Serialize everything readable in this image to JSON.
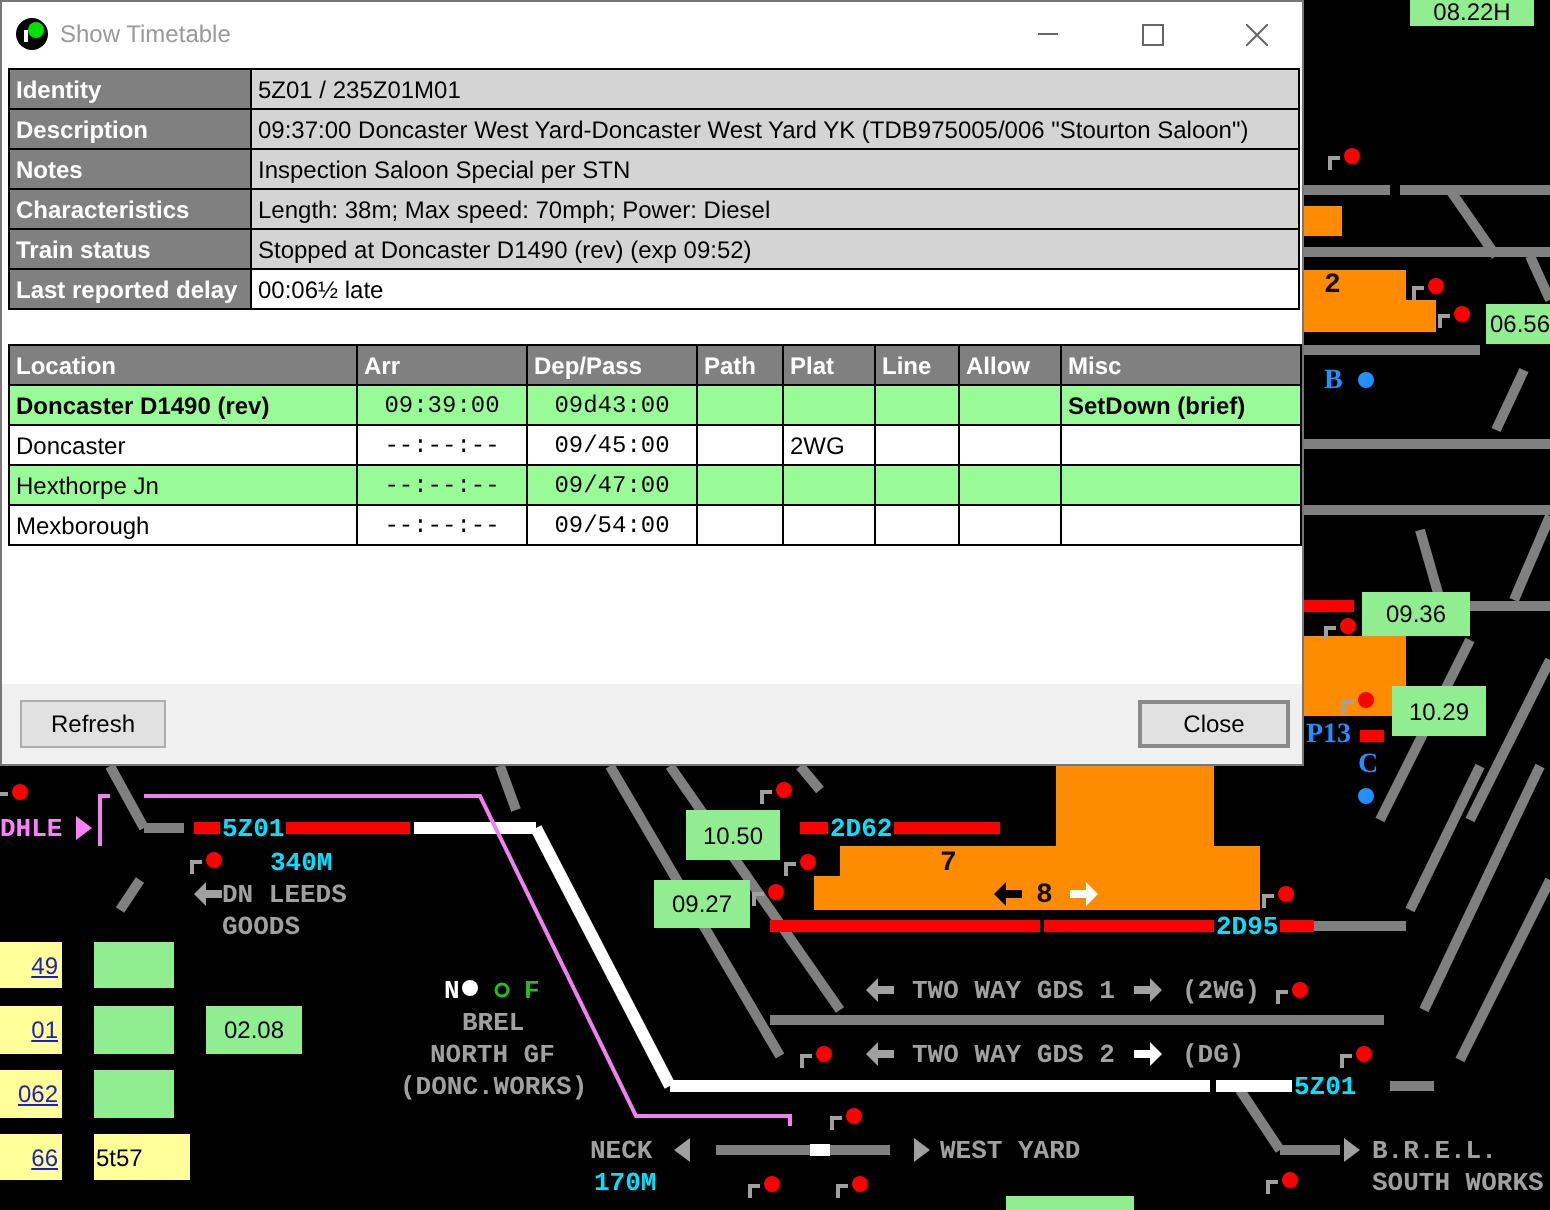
{
  "window": {
    "title": "Show Timetable"
  },
  "details": [
    {
      "label": "Identity",
      "value": "5Z01 / 235Z01M01"
    },
    {
      "label": "Description",
      "value": "09:37:00 Doncaster West Yard-Doncaster West Yard YK (TDB975005/006 \"Stourton Saloon\")"
    },
    {
      "label": "Notes",
      "value": "Inspection Saloon Special per STN"
    },
    {
      "label": "Characteristics",
      "value": "Length: 38m; Max speed: 70mph; Power: Diesel"
    },
    {
      "label": "Train status",
      "value": "Stopped at Doncaster D1490 (rev) (exp 09:52)"
    },
    {
      "label": "Last reported delay",
      "value": "00:06½ late"
    }
  ],
  "timetable": {
    "columns": [
      "Location",
      "Arr",
      "Dep/Pass",
      "Path",
      "Plat",
      "Line",
      "Allow",
      "Misc"
    ],
    "rows": [
      {
        "highlighted": true,
        "current": true,
        "location": "Doncaster D1490 (rev)",
        "arr": "09:39:00",
        "dep_pass": "09d43:00",
        "misc": "SetDown (brief)"
      },
      {
        "highlighted": false,
        "current": false,
        "location": "Doncaster",
        "arr": "--:--:--",
        "dep_pass": "09/45:00",
        "plat": "2WG"
      },
      {
        "highlighted": true,
        "current": false,
        "location": "Hexthorpe Jn",
        "arr": "--:--:--",
        "dep_pass": "09/47:00"
      },
      {
        "highlighted": false,
        "current": false,
        "location": "Mexborough",
        "arr": "--:--:--",
        "dep_pass": "09/54:00"
      }
    ]
  },
  "buttons": [
    "Refresh",
    "Close"
  ],
  "map": {
    "labels": [
      {
        "kind": "berth",
        "text": "08.22H"
      },
      {
        "kind": "platform",
        "text": "2"
      },
      {
        "kind": "berth",
        "text": "06.56"
      },
      {
        "kind": "mark",
        "text": "B"
      },
      {
        "kind": "berth",
        "text": "09.36"
      },
      {
        "kind": "berth",
        "text": "10.29"
      },
      {
        "kind": "mark",
        "text": "P13"
      },
      {
        "kind": "mark",
        "text": "C"
      },
      {
        "kind": "signal_name",
        "text": "DHLE"
      },
      {
        "kind": "train",
        "text": "5Z01"
      },
      {
        "kind": "berth",
        "text": "10.50"
      },
      {
        "kind": "train",
        "text": "2D62"
      },
      {
        "kind": "train",
        "text": "340M"
      },
      {
        "kind": "platform",
        "text": "7"
      },
      {
        "kind": "place",
        "text": "DN LEEDS"
      },
      {
        "kind": "berth",
        "text": "09.27"
      },
      {
        "kind": "platform",
        "text": "8"
      },
      {
        "kind": "place",
        "text": "GOODS"
      },
      {
        "kind": "train",
        "text": "2D95"
      },
      {
        "kind": "berth_link",
        "text": "49"
      },
      {
        "kind": "empty_berth"
      },
      {
        "kind": "frame_normal",
        "text": "N"
      },
      {
        "kind": "frame_free",
        "text": "F"
      },
      {
        "kind": "place",
        "text": "TWO WAY GDS 1"
      },
      {
        "kind": "place",
        "text": "(2WG)"
      },
      {
        "kind": "berth_link",
        "text": "01"
      },
      {
        "kind": "empty_berth"
      },
      {
        "kind": "berth",
        "text": "02.08"
      },
      {
        "kind": "place",
        "text": "BREL"
      },
      {
        "kind": "place",
        "text": "NORTH GF"
      },
      {
        "kind": "place",
        "text": "TWO WAY GDS 2"
      },
      {
        "kind": "place",
        "text": "(DG)"
      },
      {
        "kind": "berth_link",
        "text": "062"
      },
      {
        "kind": "empty_berth"
      },
      {
        "kind": "place",
        "text": "(DONC.WORKS)"
      },
      {
        "kind": "train",
        "text": "5Z01"
      },
      {
        "kind": "berth_link",
        "text": "66"
      },
      {
        "kind": "berth_note",
        "text": "5t57"
      },
      {
        "kind": "place",
        "text": "NECK"
      },
      {
        "kind": "place",
        "text": "WEST YARD"
      },
      {
        "kind": "place",
        "text": "B.R.E.L."
      },
      {
        "kind": "train",
        "text": "170M"
      },
      {
        "kind": "place",
        "text": "SOUTH WORKS"
      },
      {
        "kind": "empty_berth"
      }
    ]
  }
}
